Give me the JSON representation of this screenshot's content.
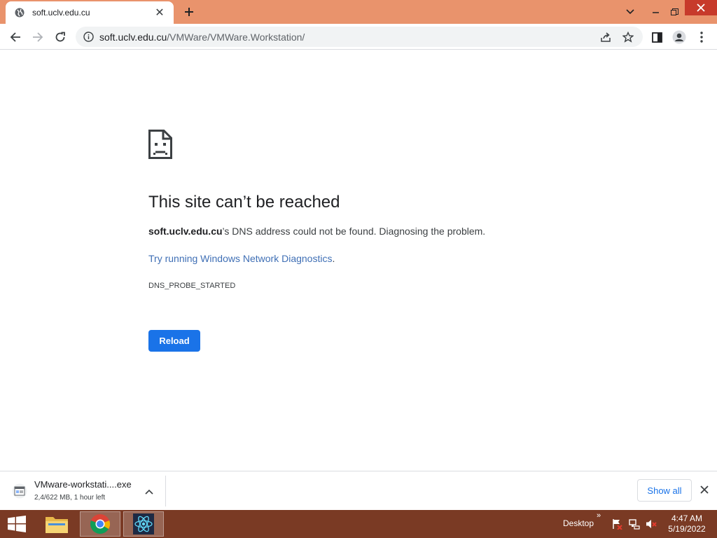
{
  "browser": {
    "tab": {
      "title": "soft.uclv.edu.cu",
      "close": "✕"
    },
    "omnibox": {
      "url_host": "soft.uclv.edu.cu",
      "url_path": "/VMWare/VMWare.Workstation/"
    },
    "colors": {
      "tabstrip": "#e9936c",
      "accent": "#1a73e8",
      "link": "#3f6fb5",
      "close": "#c73a2b"
    }
  },
  "error_page": {
    "title": "This site can’t be reached",
    "host": "soft.uclv.edu.cu",
    "description_rest": "’s DNS address could not be found. Diagnosing the problem.",
    "link_text": "Try running Windows Network Diagnostics",
    "link_suffix": ".",
    "error_code": "DNS_PROBE_STARTED",
    "reload_label": "Reload"
  },
  "download_shelf": {
    "item": {
      "name": "VMware-workstati....exe",
      "status": "2,4/622 MB, 1 hour left"
    },
    "show_all_label": "Show all"
  },
  "taskbar": {
    "desktop_label": "Desktop",
    "tray_chevron": "»",
    "clock": {
      "time": "4:47 AM",
      "date": "5/19/2022"
    },
    "colors": {
      "background": "#7a3a24"
    }
  }
}
